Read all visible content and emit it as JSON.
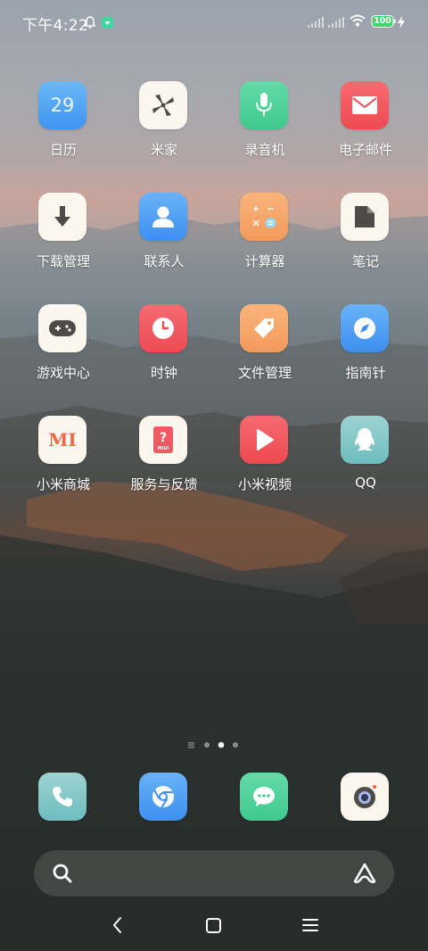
{
  "status_bar": {
    "time": "下午4:22",
    "battery": "100"
  },
  "apps": [
    {
      "label": "日历",
      "icon": "calendar-icon",
      "badge_text": "29"
    },
    {
      "label": "米家",
      "icon": "mi-home-icon"
    },
    {
      "label": "录音机",
      "icon": "microphone-icon"
    },
    {
      "label": "电子邮件",
      "icon": "mail-icon"
    },
    {
      "label": "下载管理",
      "icon": "download-icon"
    },
    {
      "label": "联系人",
      "icon": "contacts-icon"
    },
    {
      "label": "计算器",
      "icon": "calculator-icon"
    },
    {
      "label": "笔记",
      "icon": "notes-icon"
    },
    {
      "label": "游戏中心",
      "icon": "gamepad-icon"
    },
    {
      "label": "时钟",
      "icon": "clock-icon"
    },
    {
      "label": "文件管理",
      "icon": "file-tag-icon"
    },
    {
      "label": "指南针",
      "icon": "compass-icon"
    },
    {
      "label": "小米商城",
      "icon": "mi-store-icon",
      "badge_text": "MI"
    },
    {
      "label": "服务与反馈",
      "icon": "service-feedback-icon",
      "badge_text": "MIUI"
    },
    {
      "label": "小米视频",
      "icon": "video-play-icon"
    },
    {
      "label": "QQ",
      "icon": "qq-penguin-icon"
    }
  ],
  "dock": [
    {
      "icon": "phone-icon"
    },
    {
      "icon": "browser-icon"
    },
    {
      "icon": "messages-icon"
    },
    {
      "icon": "camera-icon"
    }
  ],
  "page_indicator": {
    "pages": 3,
    "current": 2
  },
  "colors": {
    "calendar": "#5aa9f5",
    "mihome": "#fbf7ef",
    "recorder": "#4fd39a",
    "mail": "#f2545b",
    "download": "#fbf7ef",
    "contacts": "#4f9ef5",
    "calculator": "#f7a86b",
    "notes": "#fbf7ef",
    "game": "#fbf7ef",
    "clock": "#f05a63",
    "files": "#f7a86b",
    "compass": "#4f9ef5",
    "store": "#fbf7ef",
    "service": "#fbf7ef",
    "video": "#f25158",
    "qq": "#7fc7c8"
  }
}
